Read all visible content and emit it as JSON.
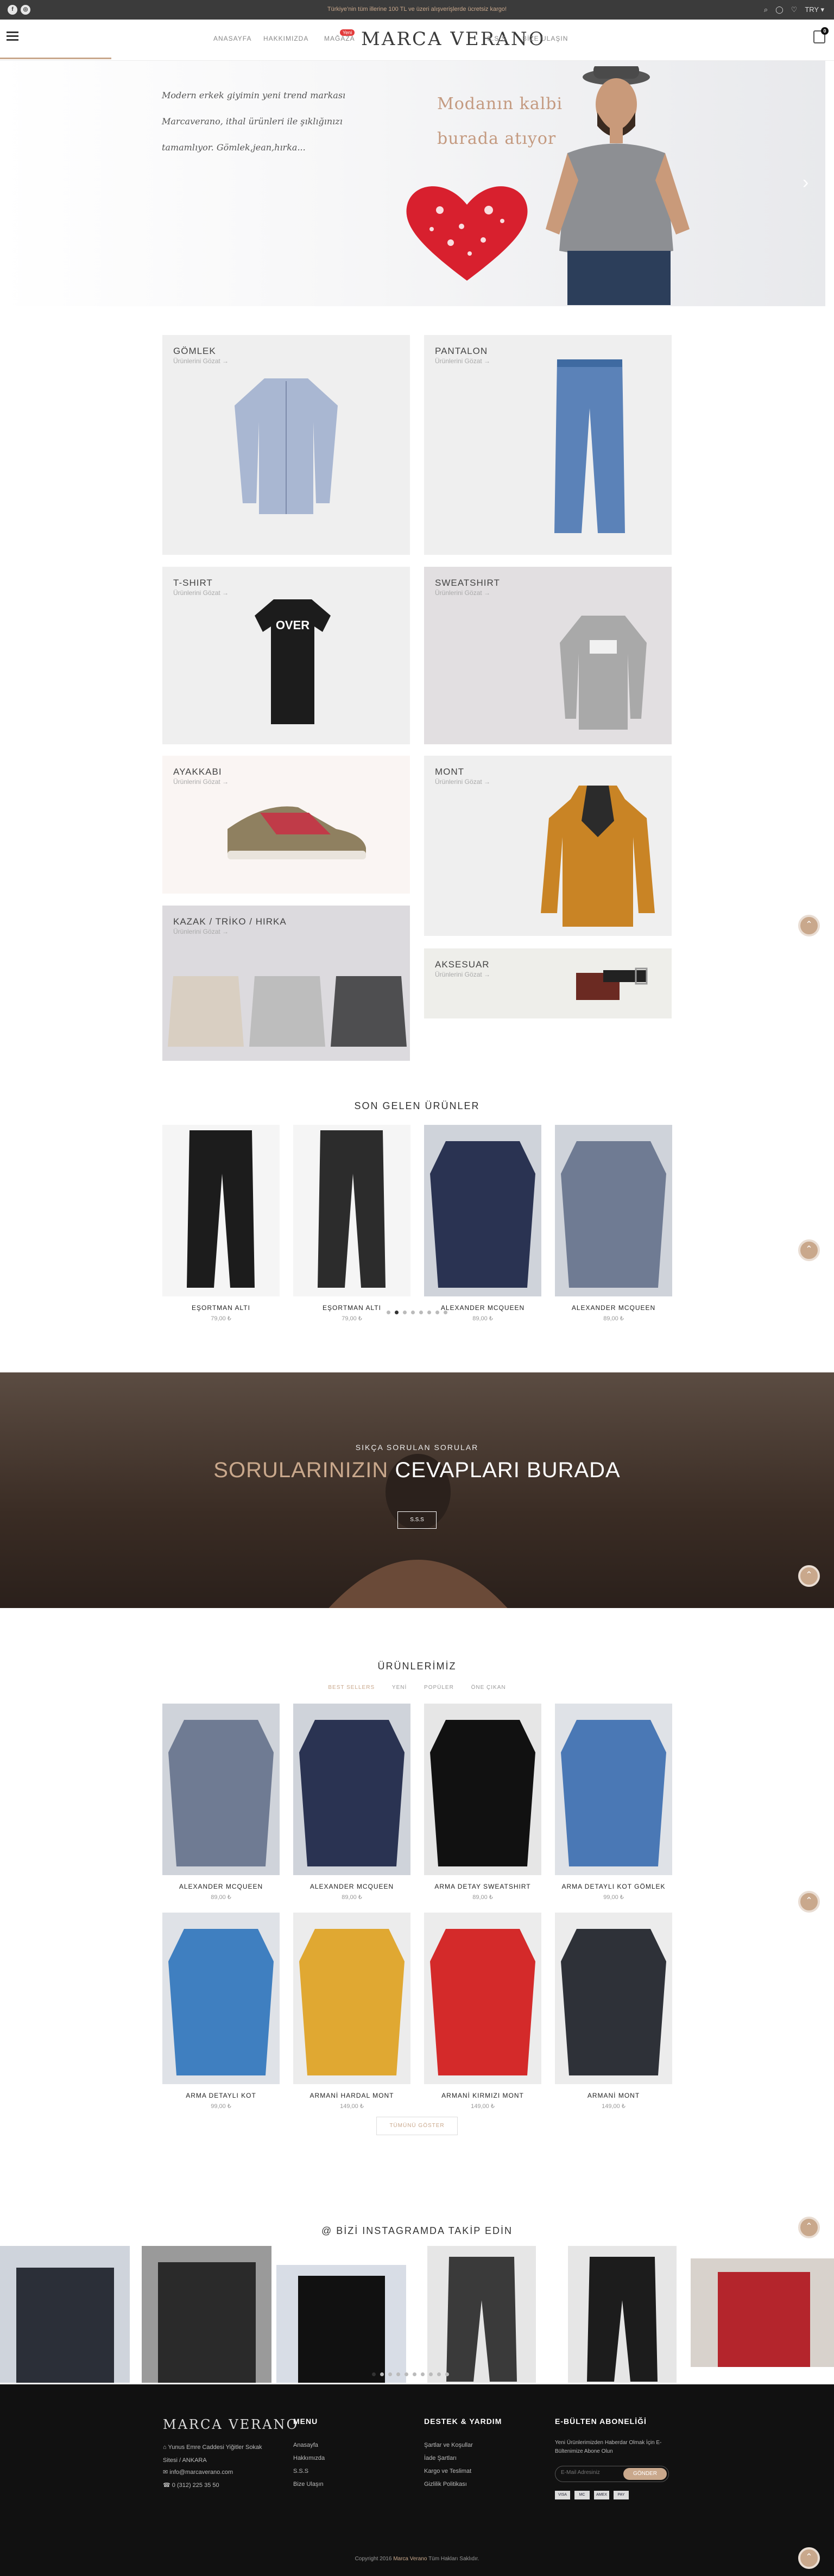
{
  "topbar": {
    "message": "Türkiye’nin tüm illerine 100 TL ve üzeri alışverişlerde ücretsiz kargo!",
    "social": [
      "f",
      "◎"
    ],
    "icons": [
      "search-icon",
      "user-icon",
      "heart-icon",
      "currency-icon"
    ],
    "currency": "TRY"
  },
  "header": {
    "nav_left": [
      "ANASAYFA",
      "HAKKIMIZDA",
      "MAĞAZA"
    ],
    "nav_right": [
      "S.S.S",
      "BİZE ULAŞIN"
    ],
    "new_badge": "Yeni",
    "logo": "MARCA VERANO",
    "cart_count": "0"
  },
  "hero": {
    "script_lines": [
      "Modern erkek giyimin yeni trend markası",
      "Marcaverano, ithal ürünleri ile şıklığınızı",
      "tamamlıyor. Gömlek,jean,hırka..."
    ],
    "title_lines": [
      "Modanın kalbi",
      "burada atıyor"
    ],
    "arrow_prev": "‹",
    "arrow_next": "›"
  },
  "categories": [
    {
      "title": "GÖMLEK",
      "sub": "Ürünlerini Gözat"
    },
    {
      "title": "PANTALON",
      "sub": "Ürünlerini Gözat"
    },
    {
      "title": "T-SHIRT",
      "sub": "Ürünlerini Gözat"
    },
    {
      "title": "SWEATSHIRT",
      "sub": "Ürünlerini Gözat"
    },
    {
      "title": "AYAKKABI",
      "sub": "Ürünlerini Gözat"
    },
    {
      "title": "MONT",
      "sub": "Ürünlerini Gözat"
    },
    {
      "title": "KAZAK / TRİKO / HIRKA",
      "sub": "Ürünlerini Gözat"
    },
    {
      "title": "AKSESUAR",
      "sub": "Ürünlerini Gözat"
    }
  ],
  "latest": {
    "title": "SON GELEN ÜRÜNLER",
    "items": [
      {
        "name": "EŞORTMAN ALTI",
        "price": "79,00 ₺"
      },
      {
        "name": "EŞORTMAN ALTI",
        "price": "79,00 ₺"
      },
      {
        "name": "ALEXANDER MCQUEEN",
        "price": "89,00 ₺"
      },
      {
        "name": "ALEXANDER MCQUEEN",
        "price": "89,00 ₺"
      }
    ],
    "dot_count": 8,
    "active_dot": 1
  },
  "faq": {
    "kicker": "SIKÇA SORULAN SORULAR",
    "title_a": "SORULARINIZIN",
    "title_b": "CEVAPLARI BURADA",
    "button": "S.S.S"
  },
  "products": {
    "title": "ÜRÜNLERİMİZ",
    "tabs": [
      "BEST SELLERS",
      "YENİ",
      "POPÜLER",
      "ÖNE ÇIKAN"
    ],
    "items": [
      {
        "name": "ALEXANDER MCQUEEN",
        "price": "89,00 ₺"
      },
      {
        "name": "ALEXANDER MCQUEEN",
        "price": "89,00 ₺"
      },
      {
        "name": "ARMA DETAY SWEATSHIRT",
        "price": "89,00 ₺"
      },
      {
        "name": "ARMA DETAYLI KOT GÖMLEK",
        "price": "99,00 ₺"
      },
      {
        "name": "ARMA DETAYLI KOT",
        "price": "99,00 ₺"
      },
      {
        "name": "ARMANİ HARDAL MONT",
        "price": "149,00 ₺"
      },
      {
        "name": "ARMANİ KIRMIZI MONT",
        "price": "149,00 ₺"
      },
      {
        "name": "ARMANİ MONT",
        "price": "149,00 ₺"
      }
    ],
    "all_button": "TÜMÜNÜ GÖSTER"
  },
  "instagram": {
    "title": "@ BİZİ INSTAGRAMDA TAKİP EDİN",
    "dot_count": 10,
    "active_dot": 0
  },
  "footer": {
    "logo": "MARCA VERANO",
    "address": "Yunus Emre Caddesi Yiğitler Sokak Sitesi / ANKARA",
    "email": "info@marcaverano.com",
    "phone": "0 (312) 225 35 50",
    "menu_title": "MENU",
    "menu": [
      "Anasayfa",
      "Hakkımızda",
      "S.S.S",
      "Bize Ulaşın"
    ],
    "support_title": "DESTEK & YARDIM",
    "support": [
      "Şartlar ve Koşullar",
      "İade Şartları",
      "Kargo ve Teslimat",
      "Gizlilik Politikası"
    ],
    "news_title": "E-BÜLTEN ABONELİĞİ",
    "news_text": "Yeni Ürünlerimizden Haberdar Olmak İçin E-Bültenimize Abone Olun",
    "email_placeholder": "E-Mail Adresiniz",
    "send": "GÖNDER",
    "payments": [
      "VISA",
      "MC",
      "AMEX",
      "PAY"
    ],
    "copyright_a": "Copyright 2016",
    "copyright_brand": "Marca Verano",
    "copyright_b": "Tüm Hakları Saklıdır."
  },
  "colors": {
    "accent": "#c9a88c",
    "dark": "#111111",
    "topbar": "#3b3b3b"
  }
}
